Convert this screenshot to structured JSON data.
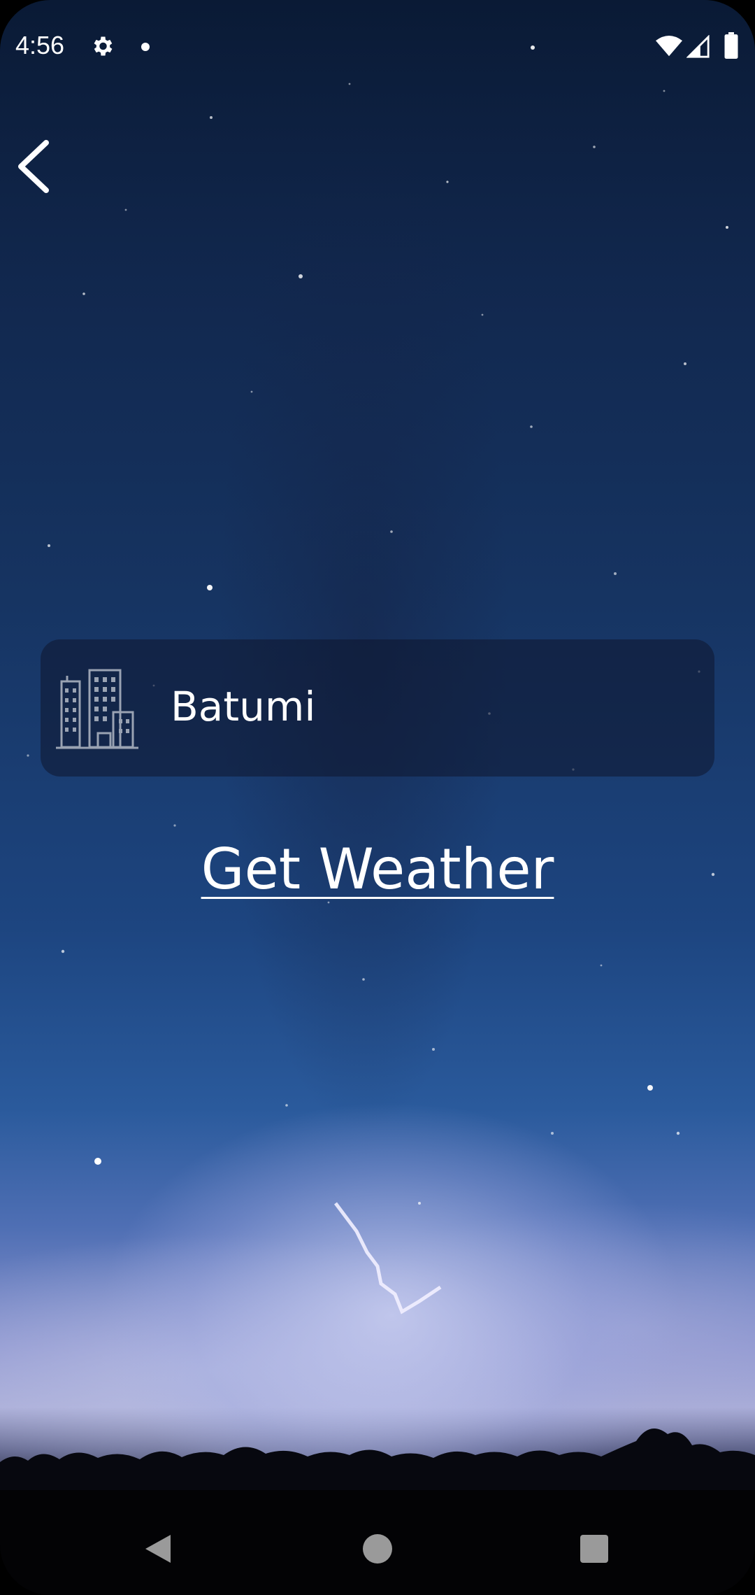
{
  "status_bar": {
    "time": "4:56",
    "icons": [
      "gear-icon",
      "notification-dot-icon",
      "wifi-icon",
      "signal-icon",
      "battery-icon"
    ]
  },
  "toolbar": {
    "back_icon": "chevron-left-icon"
  },
  "city_input": {
    "icon": "city-buildings-icon",
    "value": "Batumi"
  },
  "get_weather_label": "Get Weather",
  "navigation_bar": {
    "icons": [
      "nav-back-icon",
      "nav-home-icon",
      "nav-recents-icon"
    ]
  },
  "colors": {
    "text": "#ffffff",
    "field_background": "rgba(15,22,45,0.55)",
    "nav_icon": "#9a9a9a"
  }
}
